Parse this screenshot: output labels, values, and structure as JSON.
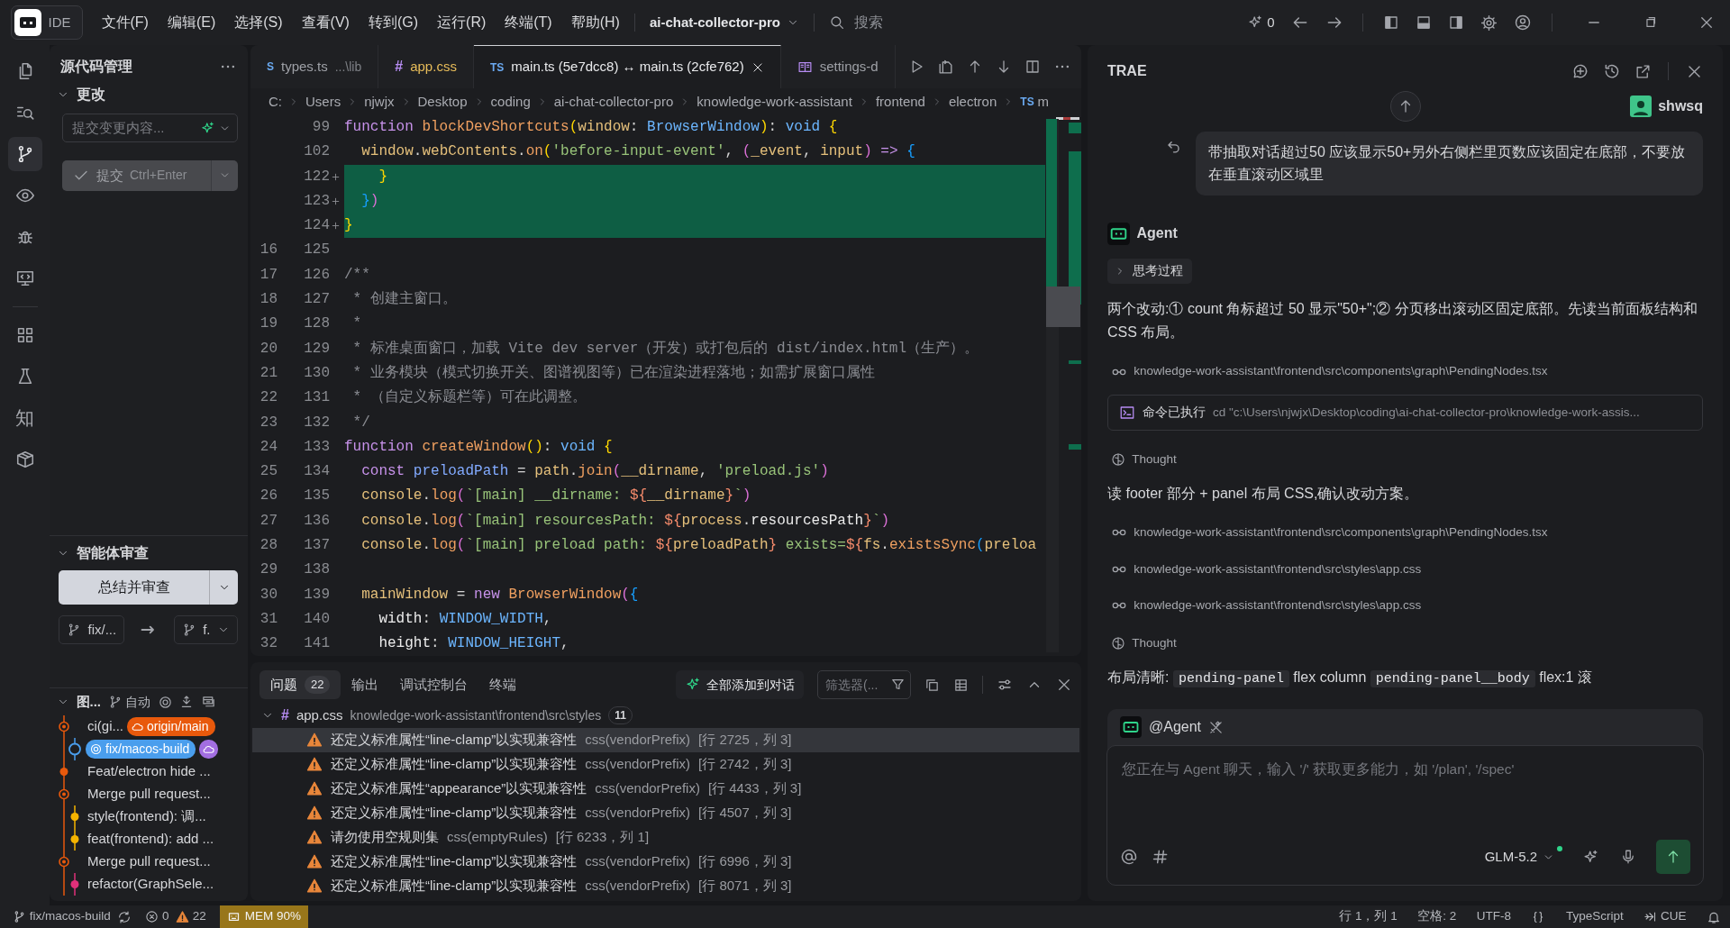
{
  "title_bar": {
    "app_label": "IDE",
    "menus": [
      "文件(F)",
      "编辑(E)",
      "选择(S)",
      "查看(V)",
      "转到(G)",
      "运行(R)",
      "终端(T)",
      "帮助(H)"
    ],
    "project": "ai-chat-collector-pro",
    "search_placeholder": "搜索",
    "credit_count": "0"
  },
  "activity_bar": {
    "top": [
      {
        "kind": "files",
        "selected": false
      },
      {
        "kind": "search",
        "selected": false
      },
      {
        "kind": "scm",
        "selected": true
      },
      {
        "kind": "eye",
        "selected": false
      },
      {
        "kind": "bug",
        "selected": false
      },
      {
        "kind": "monitor",
        "selected": false
      }
    ],
    "bottom": [
      {
        "kind": "grid",
        "selected": false
      },
      {
        "kind": "flask",
        "selected": false
      },
      {
        "kind": "glyph",
        "label": "知",
        "selected": false
      },
      {
        "kind": "box",
        "selected": false
      }
    ]
  },
  "sidebar": {
    "title": "源代码管理",
    "changes": {
      "header": "更改",
      "expanded": true,
      "commit_placeholder": "提交变更内容...",
      "commit_label": "提交",
      "commit_shortcut": "Ctrl+Enter",
      "commit_disabled": true
    },
    "review": {
      "header": "智能体审查",
      "expanded": true,
      "button": "总结并审查",
      "source_branch": "fix/...",
      "target_branch": "f."
    },
    "graph": {
      "header": "图...",
      "expanded": true,
      "auto_label": "自动",
      "commits": [
        {
          "kind": "ring",
          "branch_lane": false,
          "color": "#e8590c",
          "message": "ci(gi...",
          "tags": [
            {
              "kind": "remote",
              "label": "origin/main"
            }
          ]
        },
        {
          "kind": "hollow",
          "branch_lane": true,
          "color": "#4a9eed",
          "tags": [
            {
              "kind": "local",
              "label": "fix/macos-build"
            },
            {
              "kind": "cloud"
            }
          ]
        },
        {
          "kind": "dot",
          "branch_lane": false,
          "color": "#e8590c",
          "message": "Feat/electron hide ..."
        },
        {
          "kind": "ring",
          "branch_lane": false,
          "color": "#e8590c",
          "message": "Merge pull request..."
        },
        {
          "kind": "dot",
          "branch_lane": true,
          "color": "#f5b400",
          "message": "style(frontend): 调..."
        },
        {
          "kind": "dot",
          "branch_lane": true,
          "color": "#f5b400",
          "message": "feat(frontend): add ..."
        },
        {
          "kind": "ring",
          "branch_lane": false,
          "color": "#e8590c",
          "message": "Merge pull request..."
        },
        {
          "kind": "dot",
          "branch_lane": true,
          "color": "#e0307a",
          "message": "refactor(GraphSele..."
        }
      ]
    }
  },
  "editor": {
    "tabs": [
      {
        "kind": "ts",
        "icon_text": "S",
        "label": "types.ts",
        "description": "...\\lib",
        "selected": false,
        "has_problems": false
      },
      {
        "kind": "css",
        "icon_text": "#",
        "label": "app.css",
        "selected": false,
        "has_problems": true
      },
      {
        "kind": "ts",
        "icon_text": "TS",
        "label": "main.ts (5e7dcc8) ↔ main.ts (2cfe762)",
        "selected": true,
        "has_problems": false
      },
      {
        "kind": "settings",
        "label": "settings-d",
        "selected": false,
        "has_problems": false
      }
    ],
    "breadcrumbs": [
      {
        "label": "C:"
      },
      {
        "label": "Users"
      },
      {
        "label": "njwjx"
      },
      {
        "label": "Desktop"
      },
      {
        "label": "coding"
      },
      {
        "label": "ai-chat-collector-pro"
      },
      {
        "label": "knowledge-work-assistant"
      },
      {
        "label": "frontend"
      },
      {
        "label": "electron"
      },
      {
        "icon_text": "TS",
        "label": "m"
      }
    ],
    "lines": [
      {
        "new": "99",
        "added": false,
        "tokens": [
          {
            "kind": "kw",
            "text": "function"
          },
          {
            "kind": "fn",
            "text": " blockDevShortcuts"
          },
          {
            "kind": "br",
            "text": "("
          },
          {
            "kind": "var",
            "text": "window"
          },
          {
            "kind": "op",
            "text": ":"
          },
          {
            "kind": "type",
            "text": " BrowserWindow"
          },
          {
            "kind": "br",
            "text": ")"
          },
          {
            "kind": "op",
            "text": ":"
          },
          {
            "kind": "type",
            "text": " void"
          },
          {
            "kind": "br",
            "text": " {"
          }
        ]
      },
      {
        "new": "102",
        "added": false,
        "tokens": [
          {
            "kind": "var",
            "text": "  window"
          },
          {
            "kind": "op",
            "text": "."
          },
          {
            "kind": "var",
            "text": "webContents"
          },
          {
            "kind": "op",
            "text": "."
          },
          {
            "kind": "fn",
            "text": "on"
          },
          {
            "kind": "br",
            "text": "("
          },
          {
            "kind": "str",
            "text": "'before-input-event'"
          },
          {
            "kind": "op",
            "text": ","
          },
          {
            "kind": "br2",
            "text": " ("
          },
          {
            "kind": "var",
            "text": "_event"
          },
          {
            "kind": "op",
            "text": ","
          },
          {
            "kind": "var",
            "text": " input"
          },
          {
            "kind": "br2",
            "text": ")"
          },
          {
            "kind": "kw",
            "text": " =>"
          },
          {
            "kind": "br3",
            "text": " {"
          }
        ]
      },
      {
        "new": "122",
        "added": true,
        "tokens": [
          {
            "kind": "br",
            "text": "    }"
          }
        ]
      },
      {
        "new": "123",
        "added": true,
        "tokens": [
          {
            "kind": "br3",
            "text": "  }"
          },
          {
            "kind": "br2",
            "text": ")"
          }
        ]
      },
      {
        "new": "124",
        "added": true,
        "tokens": [
          {
            "kind": "br",
            "text": "}"
          }
        ]
      },
      {
        "old": "16",
        "new": "125",
        "added": false
      },
      {
        "old": "17",
        "new": "126",
        "added": false,
        "tokens": [
          {
            "kind": "cm",
            "text": "/**"
          }
        ]
      },
      {
        "old": "18",
        "new": "127",
        "added": false,
        "tokens": [
          {
            "kind": "cm",
            "text": " * 创建主窗口。"
          }
        ]
      },
      {
        "old": "19",
        "new": "128",
        "added": false,
        "tokens": [
          {
            "kind": "cm",
            "text": " *"
          }
        ]
      },
      {
        "old": "20",
        "new": "129",
        "added": false,
        "tokens": [
          {
            "kind": "cm",
            "text": " * 标准桌面窗口，加载 Vite dev server（开发）或打包后的 dist/index.html（生产）。"
          }
        ]
      },
      {
        "old": "21",
        "new": "130",
        "added": false,
        "tokens": [
          {
            "kind": "cm",
            "text": " * 业务模块（模式切换开关、图谱视图等）已在渲染进程落地；如需扩展窗口属性"
          }
        ]
      },
      {
        "old": "22",
        "new": "131",
        "added": false,
        "tokens": [
          {
            "kind": "cm",
            "text": " * （自定义标题栏等）可在此调整。"
          }
        ]
      },
      {
        "old": "23",
        "new": "132",
        "added": false,
        "tokens": [
          {
            "kind": "cm",
            "text": " */"
          }
        ]
      },
      {
        "old": "24",
        "new": "133",
        "added": false,
        "tokens": [
          {
            "kind": "kw",
            "text": "function"
          },
          {
            "kind": "fn",
            "text": " createWindow"
          },
          {
            "kind": "br",
            "text": "()"
          },
          {
            "kind": "op",
            "text": ":"
          },
          {
            "kind": "type",
            "text": " void"
          },
          {
            "kind": "br",
            "text": " {"
          }
        ]
      },
      {
        "old": "25",
        "new": "134",
        "added": false,
        "tokens": [
          {
            "kind": "kw",
            "text": "  const"
          },
          {
            "kind": "var2",
            "text": " preloadPath"
          },
          {
            "kind": "op",
            "text": " ="
          },
          {
            "kind": "var",
            "text": " path"
          },
          {
            "kind": "op",
            "text": "."
          },
          {
            "kind": "fn",
            "text": "join"
          },
          {
            "kind": "br2",
            "text": "("
          },
          {
            "kind": "var",
            "text": "__dirname"
          },
          {
            "kind": "op",
            "text": ","
          },
          {
            "kind": "str",
            "text": " 'preload.js'"
          },
          {
            "kind": "br2",
            "text": ")"
          }
        ]
      },
      {
        "old": "26",
        "new": "135",
        "added": false,
        "tokens": [
          {
            "kind": "var",
            "text": "  console"
          },
          {
            "kind": "op",
            "text": "."
          },
          {
            "kind": "fn",
            "text": "log"
          },
          {
            "kind": "br2",
            "text": "("
          },
          {
            "kind": "str",
            "text": "`[main] __dirname:"
          },
          {
            "kind": "interp",
            "text": " ${"
          },
          {
            "kind": "var",
            "text": "__dirname"
          },
          {
            "kind": "interp",
            "text": "}"
          },
          {
            "kind": "str",
            "text": "`"
          },
          {
            "kind": "br2",
            "text": ")"
          }
        ]
      },
      {
        "old": "27",
        "new": "136",
        "added": false,
        "tokens": [
          {
            "kind": "var",
            "text": "  console"
          },
          {
            "kind": "op",
            "text": "."
          },
          {
            "kind": "fn",
            "text": "log"
          },
          {
            "kind": "br2",
            "text": "("
          },
          {
            "kind": "str",
            "text": "`[main] resourcesPath:"
          },
          {
            "kind": "interp",
            "text": " ${"
          },
          {
            "kind": "var",
            "text": "process"
          },
          {
            "kind": "op",
            "text": "."
          },
          {
            "kind": "prop",
            "text": "resourcesPath"
          },
          {
            "kind": "interp",
            "text": "}"
          },
          {
            "kind": "str",
            "text": "`"
          },
          {
            "kind": "br2",
            "text": ")"
          }
        ]
      },
      {
        "old": "28",
        "new": "137",
        "added": false,
        "tokens": [
          {
            "kind": "var",
            "text": "  console"
          },
          {
            "kind": "op",
            "text": "."
          },
          {
            "kind": "fn",
            "text": "log"
          },
          {
            "kind": "br2",
            "text": "("
          },
          {
            "kind": "str",
            "text": "`[main] preload path:"
          },
          {
            "kind": "interp",
            "text": " ${"
          },
          {
            "kind": "var",
            "text": "preloadPath"
          },
          {
            "kind": "interp",
            "text": "}"
          },
          {
            "kind": "str",
            "text": " exists="
          },
          {
            "kind": "interp",
            "text": "${"
          },
          {
            "kind": "var",
            "text": "fs"
          },
          {
            "kind": "op",
            "text": "."
          },
          {
            "kind": "fn",
            "text": "existsSync"
          },
          {
            "kind": "br3",
            "text": "("
          },
          {
            "kind": "var",
            "text": "preloa"
          }
        ]
      },
      {
        "old": "29",
        "new": "138",
        "added": false
      },
      {
        "old": "30",
        "new": "139",
        "added": false,
        "tokens": [
          {
            "kind": "var",
            "text": "  mainWindow"
          },
          {
            "kind": "op",
            "text": " ="
          },
          {
            "kind": "kw",
            "text": " new"
          },
          {
            "kind": "cls",
            "text": " BrowserWindow"
          },
          {
            "kind": "br2",
            "text": "("
          },
          {
            "kind": "br3",
            "text": "{"
          }
        ]
      },
      {
        "old": "31",
        "new": "140",
        "added": false,
        "tokens": [
          {
            "kind": "prop",
            "text": "    width"
          },
          {
            "kind": "op",
            "text": ":"
          },
          {
            "kind": "const",
            "text": " WINDOW_WIDTH"
          },
          {
            "kind": "op",
            "text": ","
          }
        ]
      },
      {
        "old": "32",
        "new": "141",
        "added": false,
        "tokens": [
          {
            "kind": "prop",
            "text": "    height"
          },
          {
            "kind": "op",
            "text": ":"
          },
          {
            "kind": "const",
            "text": " WINDOW_HEIGHT"
          },
          {
            "kind": "op",
            "text": ","
          }
        ]
      }
    ]
  },
  "panel": {
    "tabs": [
      {
        "label": "问题",
        "count": "22",
        "selected": true
      },
      {
        "label": "输出",
        "selected": false
      },
      {
        "label": "调试控制台",
        "selected": false
      },
      {
        "label": "终端",
        "selected": false
      }
    ],
    "add_all_label": "全部添加到对话",
    "filter_placeholder": "筛选器(...",
    "groups": [
      {
        "icon_text": "#",
        "file": "app.css",
        "path": "knowledge-work-assistant\\frontend\\src\\styles",
        "count": "11",
        "expanded": true,
        "problems": [
          {
            "kind": "warning",
            "message": "还定义标准属性“line-clamp”以实现兼容性",
            "source": "css(vendorPrefix)",
            "location": "[行 2725，列 3]",
            "selected": true
          },
          {
            "kind": "warning",
            "message": "还定义标准属性“line-clamp”以实现兼容性",
            "source": "css(vendorPrefix)",
            "location": "[行 2742，列 3]",
            "selected": false
          },
          {
            "kind": "warning",
            "message": "还定义标准属性“appearance”以实现兼容性",
            "source": "css(vendorPrefix)",
            "location": "[行 4433，列 3]",
            "selected": false
          },
          {
            "kind": "warning",
            "message": "还定义标准属性“line-clamp”以实现兼容性",
            "source": "css(vendorPrefix)",
            "location": "[行 4507，列 3]",
            "selected": false
          },
          {
            "kind": "warning",
            "message": "请勿使用空规则集",
            "source": "css(emptyRules)",
            "location": "[行 6233，列 1]",
            "selected": false
          },
          {
            "kind": "warning",
            "message": "还定义标准属性“line-clamp”以实现兼容性",
            "source": "css(vendorPrefix)",
            "location": "[行 6996，列 3]",
            "selected": false
          },
          {
            "kind": "warning",
            "message": "还定义标准属性“line-clamp”以实现兼容性",
            "source": "css(vendorPrefix)",
            "location": "[行 8071，列 3]",
            "selected": false
          }
        ]
      }
    ]
  },
  "chat": {
    "title": "TRAE",
    "user": {
      "name": "shwsq",
      "message": "带抽取对话超过50 应该显示50+另外右侧栏里页数应该固定在底部，不要放在垂直滚动区域里"
    },
    "agent": {
      "name": "Agent"
    },
    "items": [
      {
        "kind": "thinking",
        "label": "思考过程",
        "expanded": false
      },
      {
        "kind": "text",
        "text": "两个改动:① count 角标超过 50 显示\"50+\";② 分页移出滚动区固定底部。先读当前面板结构和 CSS 布局。"
      },
      {
        "kind": "file",
        "path": "knowledge-work-assistant\\frontend\\src\\components\\graph\\PendingNodes.tsx"
      },
      {
        "kind": "command",
        "label": "命令已执行",
        "command": "cd \"c:\\Users\\njwjx\\Desktop\\coding\\ai-chat-collector-pro\\knowledge-work-assis..."
      },
      {
        "kind": "thought",
        "label": "Thought"
      },
      {
        "kind": "text",
        "text": "读 footer 部分 + panel 布局 CSS,确认改动方案。"
      },
      {
        "kind": "file",
        "path": "knowledge-work-assistant\\frontend\\src\\components\\graph\\PendingNodes.tsx"
      },
      {
        "kind": "file",
        "path": "knowledge-work-assistant\\frontend\\src\\styles\\app.css"
      },
      {
        "kind": "file",
        "path": "knowledge-work-assistant\\frontend\\src\\styles\\app.css"
      },
      {
        "kind": "thought",
        "label": "Thought"
      },
      {
        "kind": "mixed",
        "parts": [
          {
            "kind": "text",
            "text": "布局清晰:"
          },
          {
            "kind": "code",
            "text": "pending-panel"
          },
          {
            "kind": "text",
            "text": "flex column"
          },
          {
            "kind": "code",
            "text": "pending-panel__body"
          },
          {
            "kind": "text",
            "text": "flex:1 滚"
          }
        ]
      }
    ],
    "input": {
      "agent_label": "@Agent",
      "placeholder": "您正在与 Agent 聊天，输入 '/' 获取更多能力，如 '/plan', '/spec'",
      "model": "GLM-5.2"
    }
  },
  "status_bar": {
    "branch": "fix/macos-build",
    "errors": "0",
    "warnings": "22",
    "memory": "MEM 90%",
    "position": "行 1，列 1",
    "indent": "空格: 2",
    "encoding": "UTF-8",
    "language": "TypeScript",
    "extension": "CUE"
  }
}
